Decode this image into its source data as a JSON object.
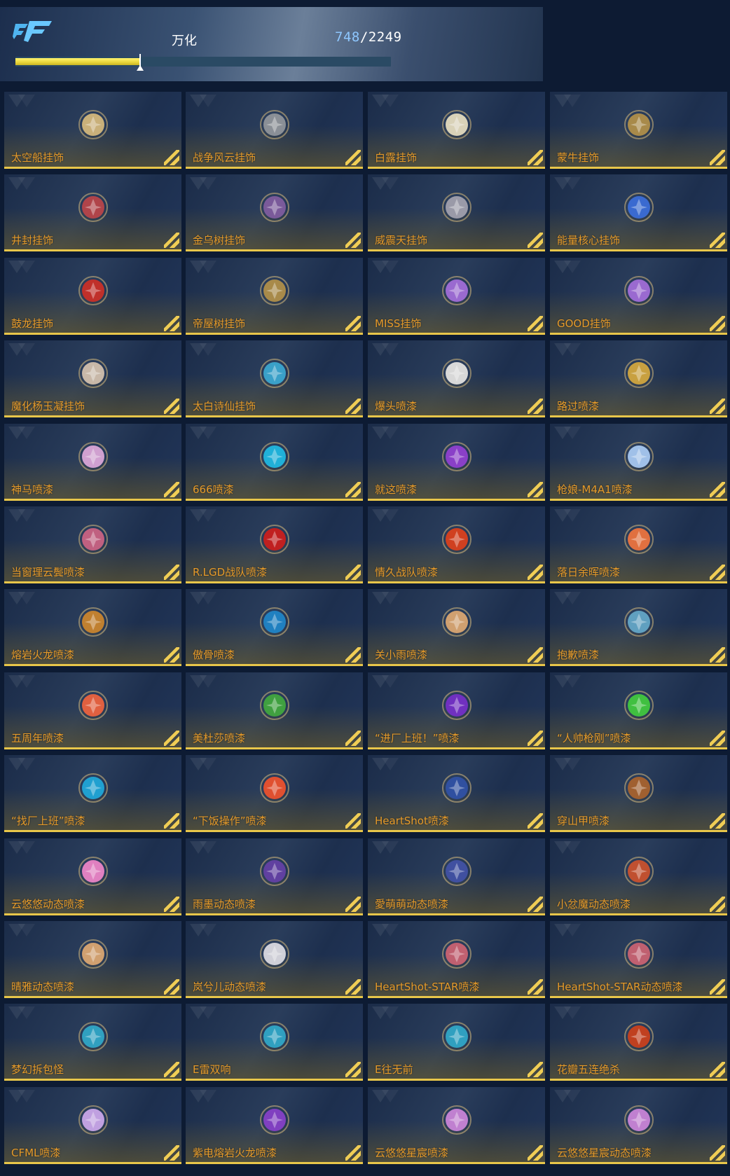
{
  "header": {
    "title": "万化",
    "current": "748",
    "total": "/2249",
    "progress_fraction": 0.332
  },
  "items": [
    {
      "label": "太空船挂饰",
      "icon": "spaceship-charm-icon",
      "color": "#c9b07a"
    },
    {
      "label": "战争风云挂饰",
      "icon": "tank-charm-icon",
      "color": "#8a8f96"
    },
    {
      "label": "白露挂饰",
      "icon": "bird-charm-icon",
      "color": "#d9d2b8"
    },
    {
      "label": "蒙牛挂饰",
      "icon": "horn-charm-icon",
      "color": "#a88a4a"
    },
    {
      "label": "井封挂饰",
      "icon": "beast-charm-icon",
      "color": "#b0444a"
    },
    {
      "label": "金乌树挂饰",
      "icon": "crow-charm-icon",
      "color": "#7a5a9a"
    },
    {
      "label": "威震天挂饰",
      "icon": "robot-charm-icon",
      "color": "#9a9aa8"
    },
    {
      "label": "能量核心挂饰",
      "icon": "energy-core-charm-icon",
      "color": "#3a6ad0"
    },
    {
      "label": "鼓龙挂饰",
      "icon": "dragon-charm-icon",
      "color": "#c0302a"
    },
    {
      "label": "帝屋树挂饰",
      "icon": "tree-charm-icon",
      "color": "#a88a4a"
    },
    {
      "label": "MISS挂饰",
      "icon": "miss-charm-icon",
      "color": "#9a6ad0"
    },
    {
      "label": "GOOD挂饰",
      "icon": "good-charm-icon",
      "color": "#9a6ad0"
    },
    {
      "label": "魔化杨玉凝挂饰",
      "icon": "mask-charm-icon",
      "color": "#c8b8a8"
    },
    {
      "label": "太白诗仙挂饰",
      "icon": "poet-charm-icon",
      "color": "#3aa0c8"
    },
    {
      "label": "爆头喷漆",
      "icon": "skull-spray-icon",
      "color": "#d8d8d8"
    },
    {
      "label": "路过喷漆",
      "icon": "pass-by-spray-icon",
      "color": "#c8a040"
    },
    {
      "label": "神马喷漆",
      "icon": "horse-spray-icon",
      "color": "#d0a0d0"
    },
    {
      "label": "666喷漆",
      "icon": "666-spray-icon",
      "color": "#20b0d8"
    },
    {
      "label": "就这喷漆",
      "icon": "star-spray-icon",
      "color": "#8a40c8"
    },
    {
      "label": "枪娘-M4A1喷漆",
      "icon": "gun-girl-spray-icon",
      "color": "#a0c0e8"
    },
    {
      "label": "当窗理云鬓喷漆",
      "icon": "girl-spray-icon",
      "color": "#c06080"
    },
    {
      "label": "R.LGD战队喷漆",
      "icon": "team-lgd-spray-icon",
      "color": "#c02020"
    },
    {
      "label": "情久战队喷漆",
      "icon": "team-shield-spray-icon",
      "color": "#d04020"
    },
    {
      "label": "落日余晖喷漆",
      "icon": "sunset-spray-icon",
      "color": "#e07040"
    },
    {
      "label": "熔岩火龙喷漆",
      "icon": "fire-dragon-spray-icon",
      "color": "#c08030"
    },
    {
      "label": "傲骨喷漆",
      "icon": "ninja-spray-icon",
      "color": "#2080c0"
    },
    {
      "label": "关小雨喷漆",
      "icon": "girl-spray-icon",
      "color": "#d0a070"
    },
    {
      "label": "抱歉喷漆",
      "icon": "sorry-spray-icon",
      "color": "#60a0c0"
    },
    {
      "label": "五周年喷漆",
      "icon": "anniversary-spray-icon",
      "color": "#e06040"
    },
    {
      "label": "美杜莎喷漆",
      "icon": "medusa-spray-icon",
      "color": "#40a040"
    },
    {
      "label": "“进厂上班！”喷漆",
      "icon": "work-spray-icon",
      "color": "#7030c0"
    },
    {
      "label": "“人帅枪刚”喷漆",
      "icon": "green-splash-spray-icon",
      "color": "#40c040"
    },
    {
      "label": "“找厂上班”喷漆",
      "icon": "blue-text-spray-icon",
      "color": "#20a0d0"
    },
    {
      "label": "“下饭操作”喷漆",
      "icon": "orange-text-spray-icon",
      "color": "#e05030"
    },
    {
      "label": "HeartShot喷漆",
      "icon": "heartshot-spray-icon",
      "color": "#3050a0"
    },
    {
      "label": "穿山甲喷漆",
      "icon": "pangolin-spray-icon",
      "color": "#a06030"
    },
    {
      "label": "云悠悠动态喷漆",
      "icon": "pink-girl-spray-icon",
      "color": "#e080c0"
    },
    {
      "label": "雨墨动态喷漆",
      "icon": "purple-girl-spray-icon",
      "color": "#6040a0"
    },
    {
      "label": "愛萌萌动态喷漆",
      "icon": "girl-spray-icon",
      "color": "#4050a0"
    },
    {
      "label": "小忿魔动态喷漆",
      "icon": "little-demon-spray-icon",
      "color": "#c05030"
    },
    {
      "label": "晴雅动态喷漆",
      "icon": "twin-tail-girl-spray-icon",
      "color": "#d0a070"
    },
    {
      "label": "岚兮儿动态喷漆",
      "icon": "silver-girl-spray-icon",
      "color": "#d0d0d8"
    },
    {
      "label": "HeartShot-STAR喷漆",
      "icon": "heartshot-star-spray-icon",
      "color": "#c06070"
    },
    {
      "label": "HeartShot-STAR动态喷漆",
      "icon": "heartshot-star-spray-icon",
      "color": "#c06070"
    },
    {
      "label": "梦幻拆包怪",
      "icon": "evolution-power-icon",
      "color": "#30a0c0"
    },
    {
      "label": "E雷双响",
      "icon": "evolution-power-icon",
      "color": "#30a0c0"
    },
    {
      "label": "E往无前",
      "icon": "evolution-power-icon",
      "color": "#30a0c0"
    },
    {
      "label": "花瓣五连绝杀",
      "icon": "five-kill-badge-icon",
      "color": "#c04020"
    },
    {
      "label": "CFML喷漆",
      "icon": "cfml-badge-icon",
      "color": "#c0a0e0"
    },
    {
      "label": "紫电熔岩火龙喷漆",
      "icon": "purple-dragon-spray-icon",
      "color": "#8040c0"
    },
    {
      "label": "云悠悠星宸喷漆",
      "icon": "star-girl-spray-icon",
      "color": "#c080d0"
    },
    {
      "label": "云悠悠星宸动态喷漆",
      "icon": "star-girl-spray-icon",
      "color": "#c080d0"
    }
  ]
}
